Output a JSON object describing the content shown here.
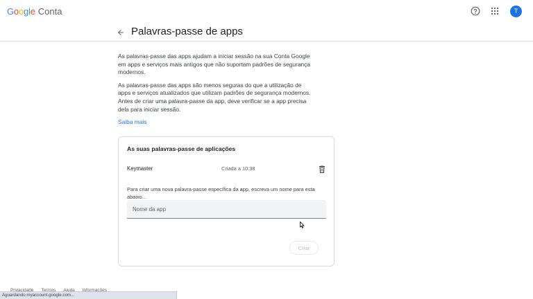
{
  "app": {
    "logo_google": "Google",
    "logo_product": "Conta",
    "avatar_letter": "T"
  },
  "header": {
    "title": "Palavras-passe de apps"
  },
  "intro": {
    "paragraph_1": "As palavras-passe das apps ajudam a iniciar sessão na sua Conta Google em apps e serviços mais antigos que não suportam padrões de segurança modernos.",
    "paragraph_2": "As palavras-passe das apps são menos seguras do que a utilização de apps e serviços atualizados que utilizam padrões de segurança modernos. Antes de criar uma palavra-passe da app, deve verificar se a app precisa dela para iniciar sessão.",
    "learn_more": "Saiba mais"
  },
  "card": {
    "title": "As suas palavras-passe de aplicações",
    "passwords": [
      {
        "name": "Keymaster",
        "created": "Criada a 10:38"
      }
    ],
    "instructions": "Para criar uma nova palavra-passe específica da app, escreva um nome para esta abaixo...",
    "input_placeholder": "Nome da app",
    "input_value": "",
    "create_label": "Criar"
  },
  "footer": {
    "links": [
      "Privacidade",
      "Termos",
      "Ajuda",
      "Informações"
    ]
  },
  "status": {
    "text": "Aguardando myaccount.google.com..."
  },
  "colors": {
    "accent": "#1a73e8",
    "google_blue": "#4285f4",
    "google_red": "#ea4335",
    "google_yellow": "#fbbc05",
    "google_green": "#34a853"
  },
  "icons": {
    "help": "help-circle-icon",
    "apps": "apps-grid-icon",
    "back": "arrow-back-icon",
    "delete": "trash-icon",
    "cursor": "mouse-pointer-icon"
  }
}
